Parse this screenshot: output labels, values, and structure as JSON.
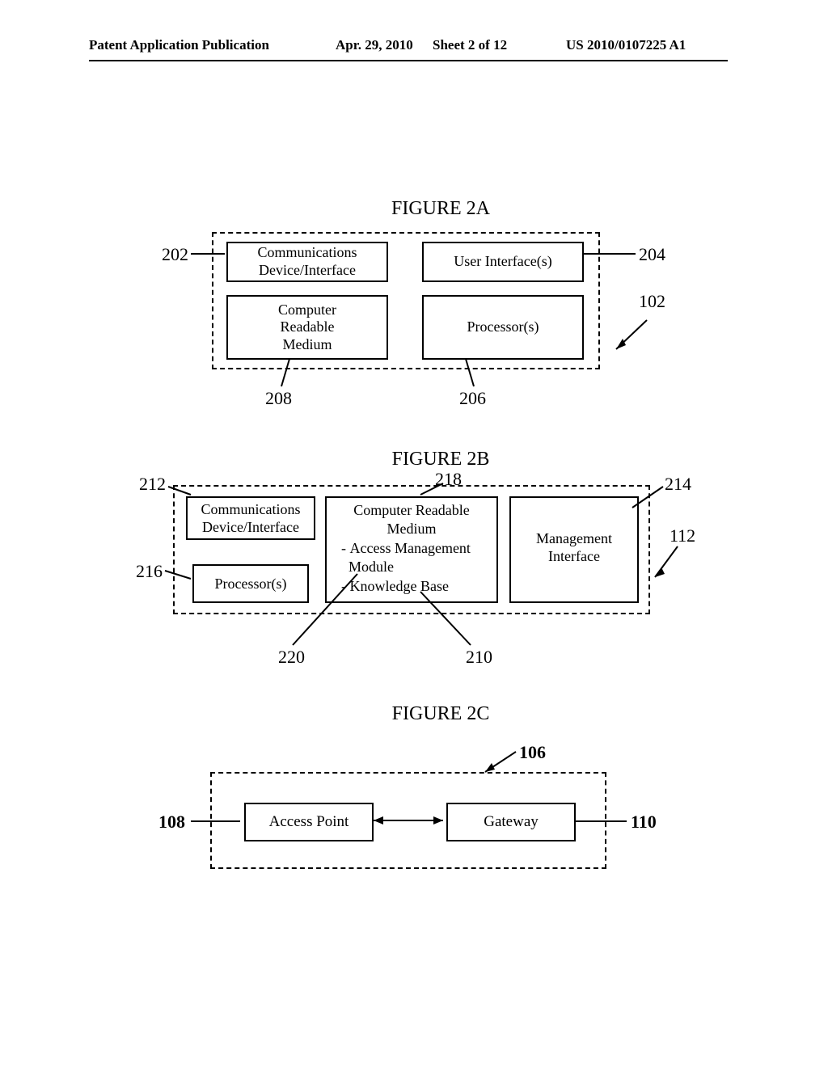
{
  "header": {
    "publication": "Patent Application Publication",
    "date": "Apr. 29, 2010",
    "sheet": "Sheet 2 of 12",
    "pubno": "US 2010/0107225 A1"
  },
  "figures": {
    "a": {
      "title": "FIGURE 2A",
      "boxes": {
        "comm": "Communications\nDevice/Interface",
        "ui": "User Interface(s)",
        "crm": "Computer\nReadable\nMedium",
        "proc": "Processor(s)"
      },
      "refs": {
        "r202": "202",
        "r204": "204",
        "r206": "206",
        "r208": "208",
        "r102": "102"
      }
    },
    "b": {
      "title": "FIGURE 2B",
      "boxes": {
        "comm": "Communications\nDevice/Interface",
        "proc": "Processor(s)",
        "crm_title": "Computer Readable\nMedium",
        "crm_item1": "- Access Management\n  Module",
        "crm_item2": "- Knowledge Base",
        "mgmt": "Management\nInterface"
      },
      "refs": {
        "r212": "212",
        "r214": "214",
        "r216": "216",
        "r218": "218",
        "r220": "220",
        "r210": "210",
        "r112": "112"
      }
    },
    "c": {
      "title": "FIGURE 2C",
      "boxes": {
        "ap": "Access Point",
        "gw": "Gateway"
      },
      "refs": {
        "r106": "106",
        "r108": "108",
        "r110": "110"
      }
    }
  }
}
